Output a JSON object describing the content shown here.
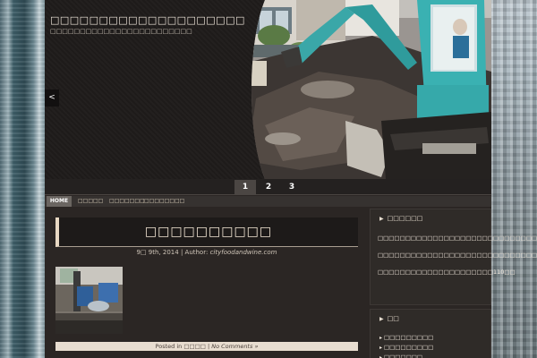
{
  "site": {
    "title": "□□□□□□□□□□□□□□□□□□□□",
    "description": "□□□□□□□□□□□□□□□□□□□□□□□□"
  },
  "slider": {
    "prev_icon": "<",
    "pages": [
      "1",
      "2",
      "3"
    ],
    "active_page": "1"
  },
  "nav": {
    "items": [
      "HOME",
      "□□□□□",
      "□□□□□□□",
      "□□□□□□□□"
    ]
  },
  "post": {
    "title": "□□□□□□□□□□",
    "date": "9□ 9th, 2014",
    "author_prefix": " | Author: ",
    "author": "cityfoodandwine.com",
    "footer_prefix": "Posted in ",
    "category": "□□□□",
    "footer_sep": " | ",
    "comments": "No Comments »"
  },
  "sidebar": {
    "widget1": {
      "title": "□□□□□□",
      "paragraphs": [
        "□□□□□□□□□□□□□□□□□□□□□□□□□□□□□□",
        "□□□□□□□□□□□□□□□□□□□□□□□□□□□□□□",
        "□□□□□□□□□□□□□□□□□□□□□110□□"
      ]
    },
    "widget2": {
      "title": "□□",
      "items": [
        "□□□□□□□□□",
        "□□□□□□□□□",
        "□□□□□□□"
      ]
    }
  },
  "colors": {
    "page_bg": "#2b2624",
    "header_bg": "#1f1c1b",
    "accent_cream": "#e8ddd0",
    "nav_active": "#6a6561"
  }
}
